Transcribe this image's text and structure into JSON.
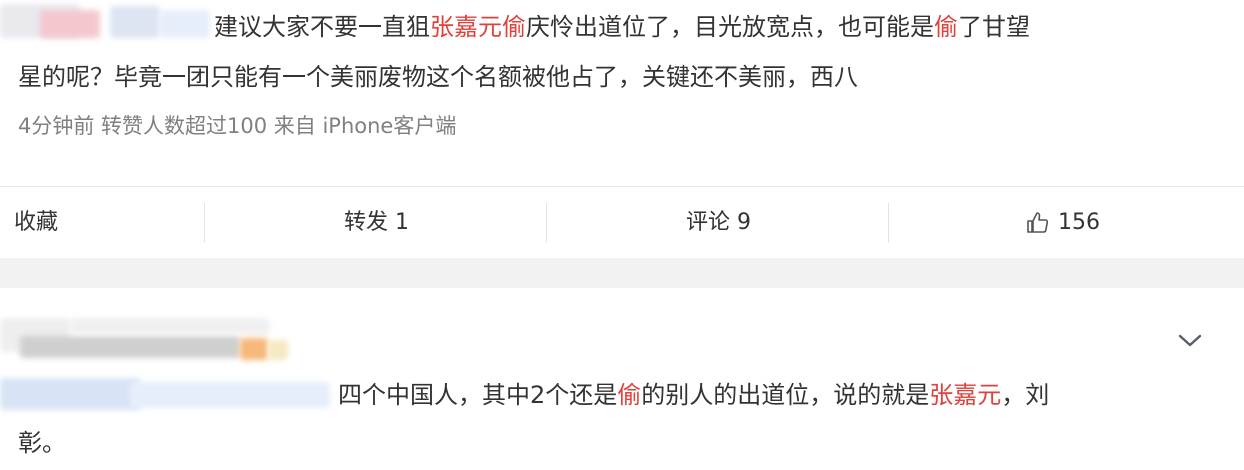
{
  "post1": {
    "line1_a": "建议大家不要一直狙",
    "line1_hl1": "张嘉元偷",
    "line1_b": "庆怜出道位了，目光放宽点，也可能是",
    "line1_hl2": "偷",
    "line1_c": "了甘望",
    "line2": "星的呢？毕竟一团只能有一个美丽废物这个名额被他占了，关键还不美丽，西八",
    "meta": "4分钟前  转赞人数超过100  来自 iPhone客户端"
  },
  "actions": {
    "favorite": "收藏",
    "repost": "转发 1",
    "comment": "评论 9",
    "like_count": "156"
  },
  "post2": {
    "line1_a": "四个中国人，其中2个还是",
    "line1_hl1": "偷",
    "line1_b": "的别人的出道位，说的就是",
    "line1_hl2": "张嘉元",
    "line1_c": "，刘",
    "line2": "彰。"
  },
  "colors": {
    "highlight": "#e0413a",
    "meta": "#808080",
    "separator": "#f2f2f2"
  }
}
